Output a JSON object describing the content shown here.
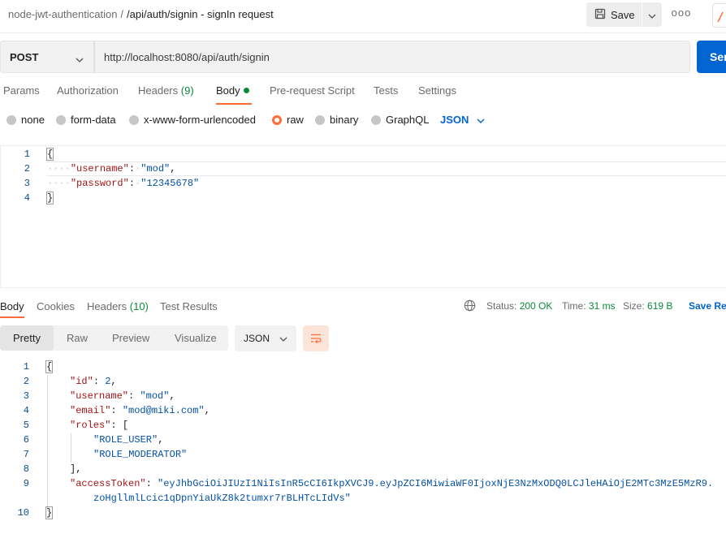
{
  "header": {
    "collection": "node-jwt-authentication",
    "separator": "/",
    "request_name": "/api/auth/signin - signIn request",
    "save_label": "Save",
    "more_label": "ooo"
  },
  "request": {
    "method": "POST",
    "url": "http://localhost:8080/api/auth/signin",
    "send_label": "Send",
    "tabs": {
      "params": "Params",
      "authorization": "Authorization",
      "headers": "Headers",
      "headers_count": "(9)",
      "body": "Body",
      "pre_request": "Pre-request Script",
      "tests": "Tests",
      "settings": "Settings"
    },
    "body_types": {
      "none": "none",
      "form_data": "form-data",
      "urlencoded": "x-www-form-urlencoded",
      "raw": "raw",
      "binary": "binary",
      "graphql": "GraphQL",
      "selected": "raw",
      "format": "JSON"
    },
    "line_numbers": [
      "1",
      "2",
      "3",
      "4"
    ],
    "lines": {
      "l1_brace": "{",
      "l2_key": "\"username\"",
      "l2_colon": ":",
      "l2_val": "\"mod\"",
      "l2_comma": ",",
      "l3_key": "\"password\"",
      "l3_colon": ":",
      "l3_val": "\"12345678\"",
      "l4_brace": "}"
    }
  },
  "response": {
    "tabs": {
      "body": "Body",
      "cookies": "Cookies",
      "headers": "Headers",
      "headers_count": "(10)",
      "test_results": "Test Results"
    },
    "status_label": "Status:",
    "status_value": "200 OK",
    "time_label": "Time:",
    "time_value": "31 ms",
    "size_label": "Size:",
    "size_value": "619 B",
    "save_label": "Save Re",
    "views": {
      "pretty": "Pretty",
      "raw": "Raw",
      "preview": "Preview",
      "visualize": "Visualize"
    },
    "format": "JSON",
    "line_numbers": [
      "1",
      "2",
      "3",
      "4",
      "5",
      "6",
      "7",
      "8",
      "9",
      "10"
    ],
    "lines": {
      "l1": "{",
      "id_key": "\"id\"",
      "id_val": "2",
      "username_key": "\"username\"",
      "username_val": "\"mod\"",
      "email_key": "\"email\"",
      "email_val": "\"mod@miki.com\"",
      "roles_key": "\"roles\"",
      "roles_open": "[",
      "role1": "\"ROLE_USER\"",
      "role2": "\"ROLE_MODERATOR\"",
      "roles_close": "],",
      "token_key": "\"accessToken\"",
      "token_val_1": "\"eyJhbGciOiJIUzI1NiIsInR5cCI6IkpXVCJ9.eyJpZCI6MiwiaWF0IjoxNjE3NzMxODQ0LCJleHAiOjE2MTc3MzE5MzR9.",
      "token_val_2": "zoHgllmlLcic1qDpnYiaUkZ8k2tumxr7rBLHTcLIdVs\"",
      "l10": "}"
    }
  },
  "colors": {
    "accent": "#ff6c37",
    "primary": "#0265d2",
    "success": "#0b8a3a"
  }
}
